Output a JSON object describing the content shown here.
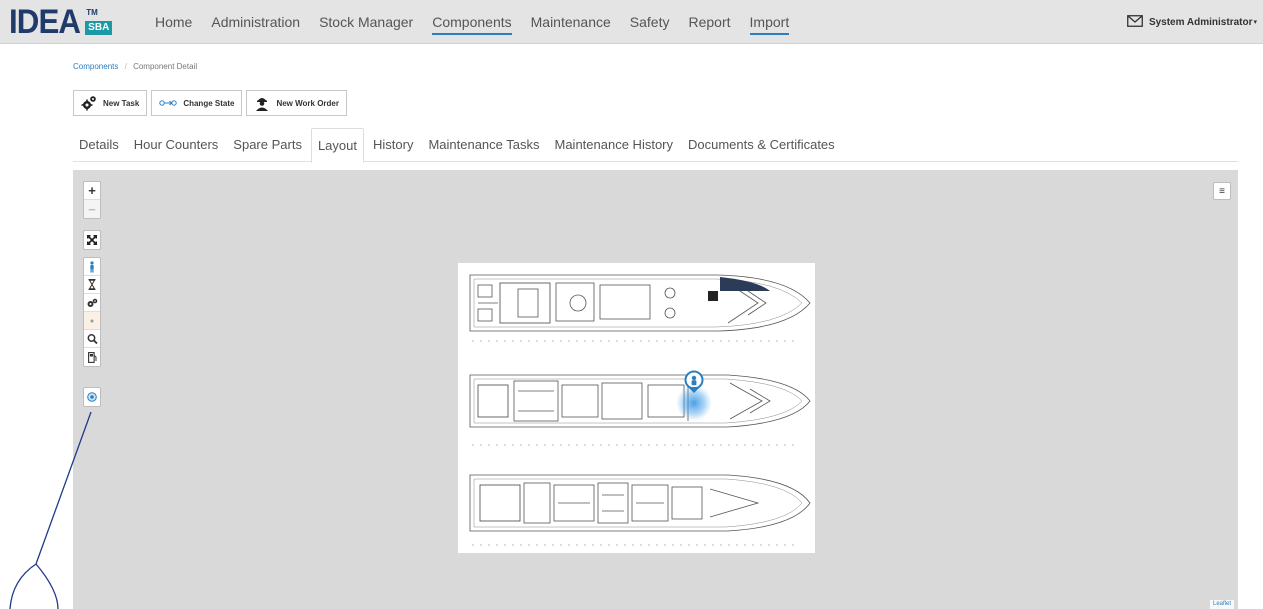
{
  "brand": {
    "name": "IDEA",
    "tm": "TM",
    "sub": "SBA"
  },
  "nav": {
    "items": [
      {
        "label": "Home",
        "active": false
      },
      {
        "label": "Administration",
        "active": false
      },
      {
        "label": "Stock Manager",
        "active": false
      },
      {
        "label": "Components",
        "active": true
      },
      {
        "label": "Maintenance",
        "active": false
      },
      {
        "label": "Safety",
        "active": false
      },
      {
        "label": "Report",
        "active": false
      },
      {
        "label": "Import",
        "active": true
      }
    ],
    "user": "System Administrator",
    "user_caret": "▾"
  },
  "breadcrumb": {
    "parent": "Components",
    "separator": "/",
    "current": "Component Detail"
  },
  "toolbar": {
    "new_task": "New Task",
    "change_state": "Change State",
    "new_work_order": "New Work Order"
  },
  "tabs": [
    {
      "label": "Details",
      "active": false
    },
    {
      "label": "Hour Counters",
      "active": false
    },
    {
      "label": "Spare Parts",
      "active": false
    },
    {
      "label": "Layout",
      "active": true
    },
    {
      "label": "History",
      "active": false
    },
    {
      "label": "Maintenance Tasks",
      "active": false
    },
    {
      "label": "Maintenance History",
      "active": false
    },
    {
      "label": "Documents & Certificates",
      "active": false
    }
  ],
  "map": {
    "zoom_in": "+",
    "zoom_out": "−",
    "fit": "⤧",
    "layers": "≡",
    "attribution": "Leaflet",
    "tools": [
      "person-icon",
      "hourglass-icon",
      "gears-icon",
      "dot-icon",
      "wrench-gear-icon",
      "fuel-pump-icon"
    ]
  },
  "colors": {
    "accent": "#2a7fc1",
    "brand": "#1f3a6b",
    "sba": "#1b9aa5",
    "map_bg": "#d9d9d9"
  }
}
